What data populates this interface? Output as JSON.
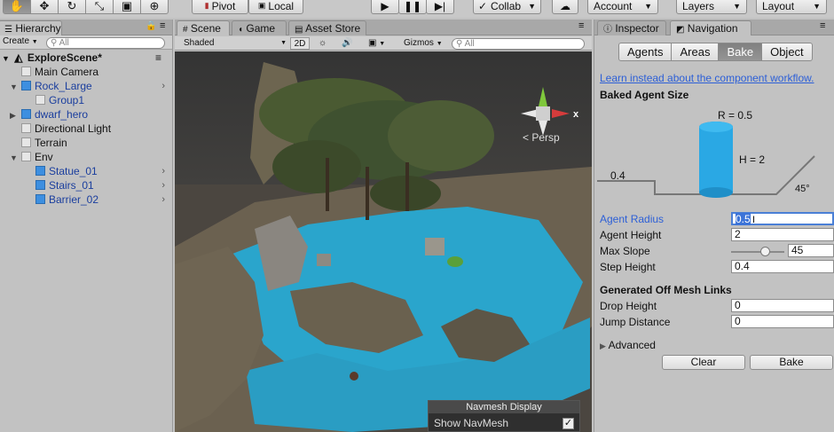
{
  "toolbar": {
    "pivot": "Pivot",
    "local": "Local",
    "collab": "Collab",
    "account": "Account",
    "layers": "Layers",
    "layout": "Layout"
  },
  "hierarchy": {
    "tab": "Hierarchy",
    "create": "Create",
    "search_placeholder": "All",
    "scene": "ExploreScene*",
    "items": [
      {
        "label": "Main Camera"
      },
      {
        "label": "Rock_Large"
      },
      {
        "label": "Group1"
      },
      {
        "label": "dwarf_hero"
      },
      {
        "label": "Directional Light"
      },
      {
        "label": "Terrain"
      },
      {
        "label": "Env"
      },
      {
        "label": "Statue_01"
      },
      {
        "label": "Stairs_01"
      },
      {
        "label": "Barrier_02"
      }
    ]
  },
  "scene_panel": {
    "tabs": [
      "Scene",
      "Game",
      "Asset Store"
    ],
    "shading": "Shaded",
    "mode_2d": "2D",
    "gizmos": "Gizmos",
    "search_placeholder": "All",
    "persp": "Persp",
    "axis_x": "x",
    "navmesh_display": {
      "title": "Navmesh Display",
      "show_label": "Show NavMesh",
      "checked": "✓"
    }
  },
  "navigation": {
    "tabs": [
      "Inspector",
      "Navigation"
    ],
    "segments": [
      "Agents",
      "Areas",
      "Bake",
      "Object"
    ],
    "link": "Learn instead about the component workflow.",
    "baked_title": "Baked Agent Size",
    "diagram": {
      "r": "R = 0.5",
      "h": "H = 2",
      "step": "0.4",
      "slope": "45°"
    },
    "fields": {
      "agent_radius": {
        "label": "Agent Radius",
        "value": "0.5"
      },
      "agent_height": {
        "label": "Agent Height",
        "value": "2"
      },
      "max_slope": {
        "label": "Max Slope",
        "value": "45",
        "slider_fraction": 0.5
      },
      "step_height": {
        "label": "Step Height",
        "value": "0.4"
      }
    },
    "offmesh_title": "Generated Off Mesh Links",
    "drop_height": {
      "label": "Drop Height",
      "value": "0"
    },
    "jump_distance": {
      "label": "Jump Distance",
      "value": "0"
    },
    "advanced": "Advanced",
    "clear": "Clear",
    "bake": "Bake"
  }
}
